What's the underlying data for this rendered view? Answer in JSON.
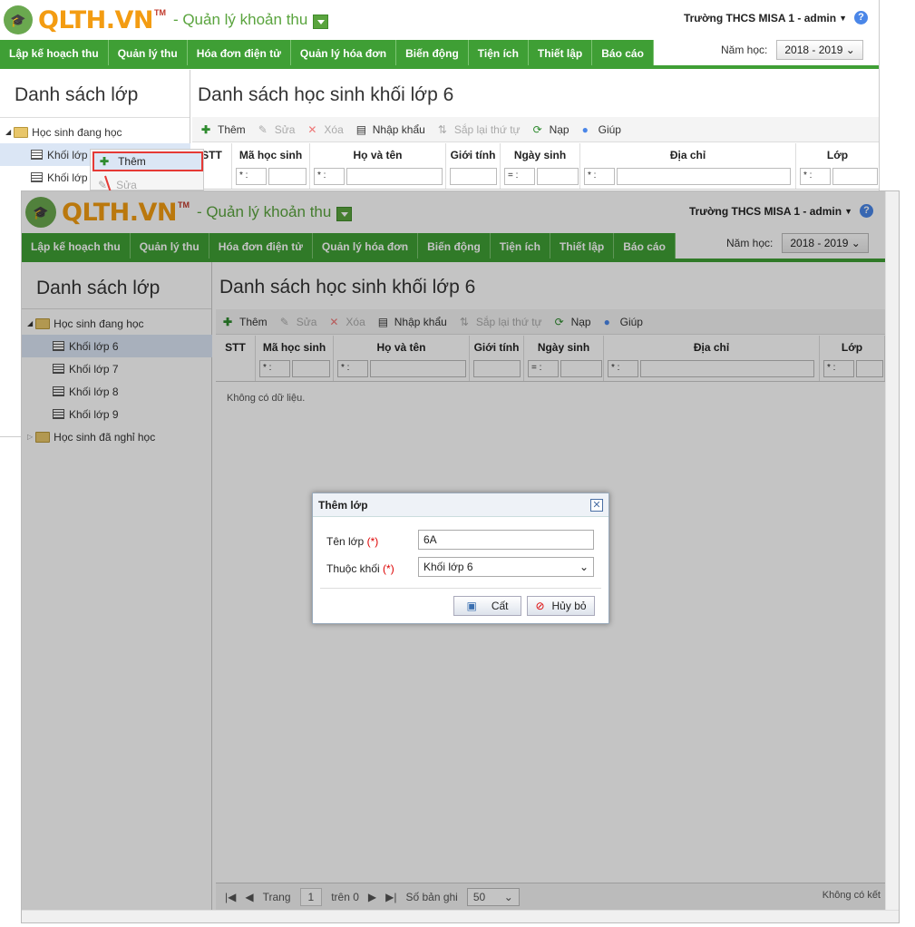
{
  "app": {
    "logo_text": "QLTH.VN",
    "logo_tm": "TM",
    "subtitle": "- Quản lý khoản thu",
    "school": "Trường THCS MISA 1 - admin",
    "help": "?"
  },
  "nav": [
    "Lập kế hoạch thu",
    "Quản lý thu",
    "Hóa đơn điện tử",
    "Quản lý hóa đơn",
    "Biến động",
    "Tiện ích",
    "Thiết lập",
    "Báo cáo"
  ],
  "year": {
    "label": "Năm học:",
    "value": "2018 - 2019"
  },
  "left_panel": {
    "title": "Danh sách lớp",
    "tree": {
      "studying": "Học sinh đang học",
      "grades": [
        "Khối lớp 6",
        "Khối lớp 7",
        "Khối lớp 8",
        "Khối lớp 9"
      ],
      "left": "Học sinh đã nghỉ học"
    },
    "bg_grades": [
      "Khối lớp",
      "Khối lớp"
    ]
  },
  "main": {
    "title": "Danh sách học sinh khối lớp 6",
    "toolbar": {
      "add": "Thêm",
      "edit": "Sửa",
      "delete": "Xóa",
      "import": "Nhập khẩu",
      "reorder": "Sắp lại thứ tự",
      "reload": "Nạp",
      "help": "Giúp"
    },
    "columns": [
      "STT",
      "Mã học sinh",
      "Họ và tên",
      "Giới tính",
      "Ngày sinh",
      "Địa chỉ",
      "Lớp"
    ],
    "filter_ops": {
      "star": "* :",
      "eq": "= :"
    },
    "empty": "Không có dữ liệu.",
    "pager": {
      "page_label": "Trang",
      "page": "1",
      "of": "trên 0",
      "rows_label": "Số bản ghi",
      "rows": "50",
      "right": "Không có kết"
    }
  },
  "context_menu": {
    "add": "Thêm",
    "edit": "Sửa"
  },
  "dialog": {
    "title": "Thêm lớp",
    "class_label": "Tên lớp",
    "class_value": "6A",
    "grade_label": "Thuộc khối",
    "grade_value": "Khối lớp 6",
    "required": "(*)",
    "save": "Cất",
    "cancel": "Hủy bỏ"
  }
}
